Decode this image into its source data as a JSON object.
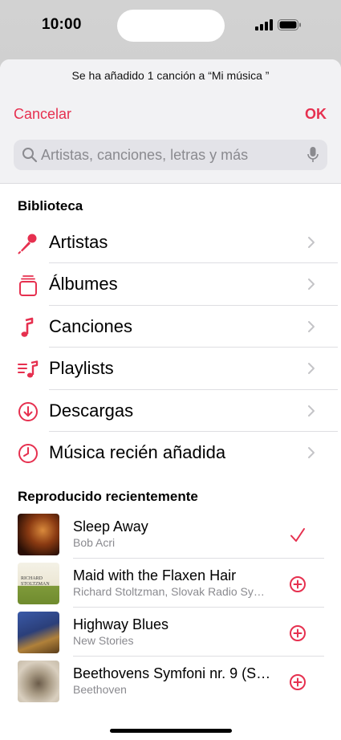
{
  "status_bar": {
    "time": "10:00"
  },
  "sheet": {
    "toast": "Se ha añadido 1 canción a “Mi música ”",
    "cancel_label": "Cancelar",
    "ok_label": "OK"
  },
  "search": {
    "placeholder": "Artistas, canciones, letras y más"
  },
  "library": {
    "title": "Biblioteca",
    "items": [
      {
        "label": "Artistas",
        "icon": "microphone-icon"
      },
      {
        "label": "Álbumes",
        "icon": "album-stack-icon"
      },
      {
        "label": "Canciones",
        "icon": "music-note-icon"
      },
      {
        "label": "Playlists",
        "icon": "playlist-icon"
      },
      {
        "label": "Descargas",
        "icon": "download-icon"
      },
      {
        "label": "Música recién añadida",
        "icon": "clock-icon"
      }
    ]
  },
  "recent": {
    "title": "Reproducido recientemente",
    "songs": [
      {
        "title": "Sleep Away",
        "artist": "Bob Acri",
        "state": "added"
      },
      {
        "title": "Maid with the Flaxen Hair",
        "artist": "Richard Stoltzman, Slovak Radio Sy…",
        "state": "add",
        "art_text": "RICHARD STOLTZMAN"
      },
      {
        "title": "Highway Blues",
        "artist": "New Stories",
        "state": "add"
      },
      {
        "title": "Beethovens Symfoni nr. 9 (S…",
        "artist": "Beethoven",
        "state": "add"
      }
    ]
  },
  "colors": {
    "accent": "#e6304f",
    "secondary_text": "#8a8a8f",
    "sheet_header": "#f2f2f4"
  }
}
